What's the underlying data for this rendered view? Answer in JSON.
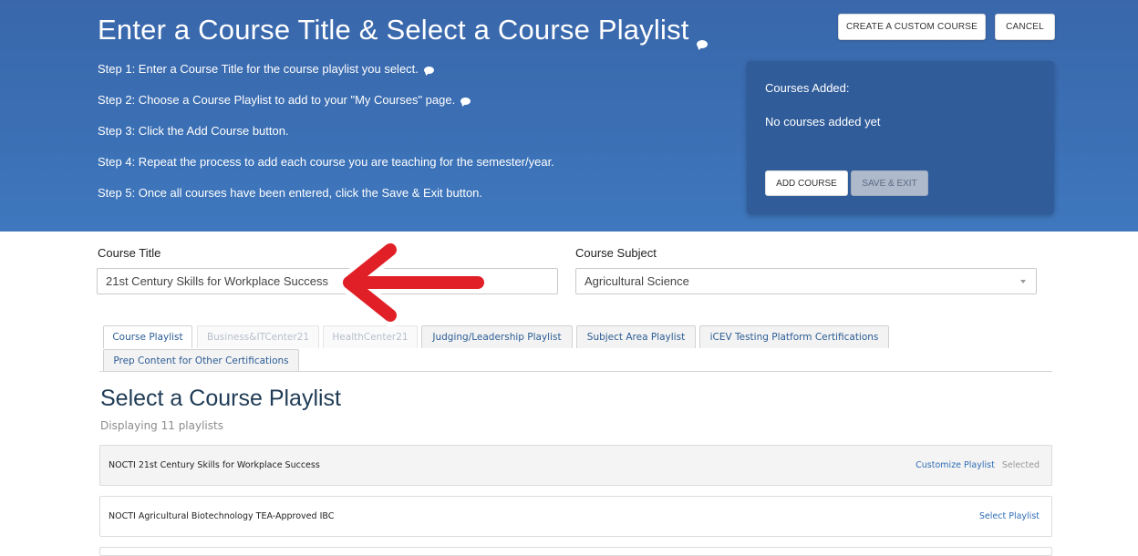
{
  "header": {
    "title": "Enter a Course Title & Select a Course Playlist",
    "steps": [
      "Step 1: Enter a Course Title for the course playlist you select.",
      "Step 2: Choose a Course Playlist to add to your \"My Courses\" page.",
      "Step 3: Click the Add Course button.",
      "Step 4: Repeat the process to add each course you are teaching for the semester/year.",
      "Step 5: Once all courses have been entered, click the Save & Exit button."
    ],
    "create_custom_label": "CREATE A CUSTOM COURSE",
    "cancel_label": "CANCEL"
  },
  "courses_panel": {
    "label": "Courses Added:",
    "empty_text": "No courses added yet",
    "add_course_label": "ADD COURSE",
    "save_exit_label": "SAVE & EXIT"
  },
  "form": {
    "course_title_label": "Course Title",
    "course_title_value": "21st Century Skills for Workplace Success",
    "course_subject_label": "Course Subject",
    "course_subject_value": "Agricultural Science"
  },
  "tabs": [
    {
      "label": "Course Playlist",
      "state": "active"
    },
    {
      "label": "Business&ITCenter21",
      "state": "disabled"
    },
    {
      "label": "HealthCenter21",
      "state": "disabled"
    },
    {
      "label": "Judging/Leadership Playlist",
      "state": "normal"
    },
    {
      "label": "Subject Area Playlist",
      "state": "normal"
    },
    {
      "label": "iCEV Testing Platform Certifications",
      "state": "normal"
    },
    {
      "label": "Prep Content for Other Certifications",
      "state": "normal"
    }
  ],
  "playlists": {
    "title": "Select a Course Playlist",
    "count_text": "Displaying 11 playlists",
    "rows": [
      {
        "name": "NOCTI 21st Century Skills for Workplace Success",
        "action": "Customize Playlist",
        "status": "Selected"
      },
      {
        "name": "NOCTI Agricultural Biotechnology TEA-Approved IBC",
        "action": "Select Playlist",
        "status": ""
      }
    ]
  },
  "icons": {
    "info_bubble": "speech-bubble-icon",
    "dropdown": "chevron-down-icon",
    "pointer": "red-arrow-annotation"
  },
  "colors": {
    "header_bg": "#3b6fb4",
    "panel_bg": "#305c9a",
    "link": "#2f6db5",
    "arrow": "#e01f26"
  }
}
